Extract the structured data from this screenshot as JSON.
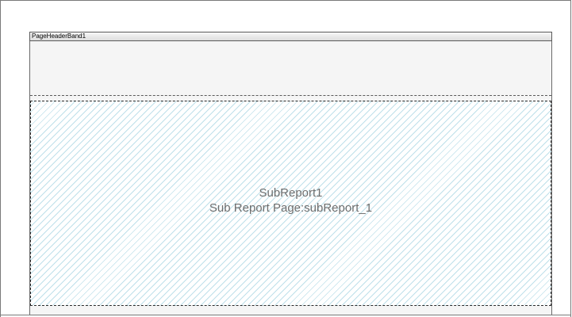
{
  "band": {
    "header_label": "PageHeaderBand1"
  },
  "subreport": {
    "name": "SubReport1",
    "page_label": "Sub Report Page:subReport_1"
  },
  "colors": {
    "hatch": "#bfe0ea",
    "band_background": "#f5f5f5",
    "text_gray": "#6e6e6e"
  }
}
